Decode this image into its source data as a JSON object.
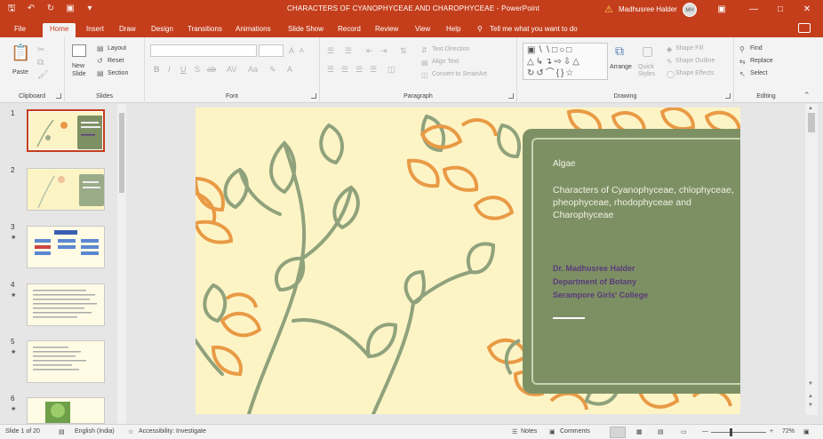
{
  "window": {
    "title": "CHARACTERS OF CYANOPHYCEAE AND CHAROPHYCEAE - PowerPoint",
    "user_name": "Madhusree Halder",
    "user_initials": "MH",
    "qat_icons": [
      "save-icon",
      "undo-icon",
      "redo-icon",
      "start-from-beginning-icon",
      "customize-qat-icon"
    ]
  },
  "ribbon_tabs": [
    "File",
    "Home",
    "Insert",
    "Draw",
    "Design",
    "Transitions",
    "Animations",
    "Slide Show",
    "Record",
    "Review",
    "View",
    "Help"
  ],
  "active_tab": "Home",
  "tell_me": "Tell me what you want to do",
  "ribbon": {
    "clipboard": {
      "label": "Clipboard",
      "paste": "Paste"
    },
    "slides": {
      "label": "Slides",
      "new_slide": "New Slide",
      "layout": "Layout",
      "reset": "Reset",
      "section": "Section"
    },
    "font": {
      "label": "Font"
    },
    "paragraph": {
      "label": "Paragraph",
      "text_direction": "Text Direction",
      "align_text": "Align Text",
      "convert_smartart": "Convert to SmartArt"
    },
    "drawing": {
      "label": "Drawing",
      "arrange": "Arrange",
      "quick_styles": "Quick Styles",
      "shape_fill": "Shape Fill",
      "shape_outline": "Shape Outline",
      "shape_effects": "Shape Effects"
    },
    "editing": {
      "label": "Editing",
      "find": "Find",
      "replace": "Replace",
      "select": "Select"
    }
  },
  "thumbnails": [
    {
      "num": "1",
      "selected": true,
      "type": "title"
    },
    {
      "num": "2",
      "selected": false,
      "type": "title"
    },
    {
      "num": "3",
      "selected": false,
      "type": "diagram"
    },
    {
      "num": "4",
      "selected": false,
      "type": "text"
    },
    {
      "num": "5",
      "selected": false,
      "type": "text"
    },
    {
      "num": "6",
      "selected": false,
      "type": "photo"
    }
  ],
  "slide": {
    "eyebrow": "Algae",
    "title": "Characters of Cyanophyceae, chlophyceae, pheophyceae, rhodophyceae and Charophyceae",
    "author_lines": [
      "Dr. Madhusree Halder",
      "Department of Botany",
      "Serampore Girls' College"
    ]
  },
  "status": {
    "slide_counter": "Slide 1 of 20",
    "language": "English (India)",
    "accessibility": "Accessibility: Investigate",
    "notes": "Notes",
    "comments": "Comments",
    "zoom": "72%"
  },
  "colors": {
    "accent": "#c43e1c",
    "slide_bg": "#fdf4c6",
    "panel": "#7d9064",
    "leaf_green": "#8fa27c",
    "leaf_orange": "#e99a45",
    "author_purple": "#5a3b7a"
  }
}
